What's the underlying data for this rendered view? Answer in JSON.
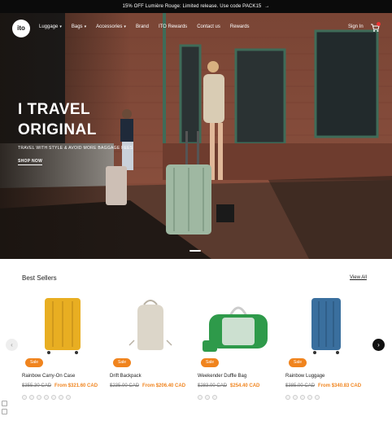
{
  "announcement": {
    "text": "15% OFF Lumière Rouge: Limited release. Use code PACK15",
    "arrow": "→"
  },
  "nav": {
    "logo": "ito",
    "items": [
      {
        "label": "Luggage",
        "has_dropdown": true
      },
      {
        "label": "Bags",
        "has_dropdown": true
      },
      {
        "label": "Accessories",
        "has_dropdown": true
      },
      {
        "label": "Brand",
        "has_dropdown": false
      },
      {
        "label": "ITO Rewards",
        "has_dropdown": false
      },
      {
        "label": "Contact us",
        "has_dropdown": false
      },
      {
        "label": "Rewards",
        "has_dropdown": false
      }
    ],
    "signin": "Sign In",
    "cart_icon": "cart-icon"
  },
  "hero": {
    "title_line1": "I TRAVEL",
    "title_line2": "ORIGINAL",
    "subtitle": "TRAVEL WITH STYLE & AVOID MORE BAGGAGE FEES",
    "cta": "SHOP NOW"
  },
  "best_sellers": {
    "title": "Best Sellers",
    "view_all": "View All",
    "products": [
      {
        "name": "Rainbow Carry-On Case",
        "badge": "Sale",
        "old_price": "$355.30 CAD",
        "new_price": "From $321.60 CAD",
        "color": "#e8ae22"
      },
      {
        "name": "Drift Backpack",
        "badge": "Sale",
        "old_price": "$235.00 CAD",
        "new_price": "From $206.40 CAD",
        "color": "#d9d4c7"
      },
      {
        "name": "Weekender Duffle Bag",
        "badge": "Sale",
        "old_price": "$283.00 CAD",
        "new_price": "$254.40 CAD",
        "color": "#2e9a4a"
      },
      {
        "name": "Rainbow Luggage",
        "badge": "Sale",
        "old_price": "$385.00 CAD",
        "new_price": "From $340.83 CAD",
        "color": "#3a6f9e"
      }
    ]
  },
  "colors": {
    "accent": "#f0841e",
    "announce_bg": "#0b0b0b"
  }
}
